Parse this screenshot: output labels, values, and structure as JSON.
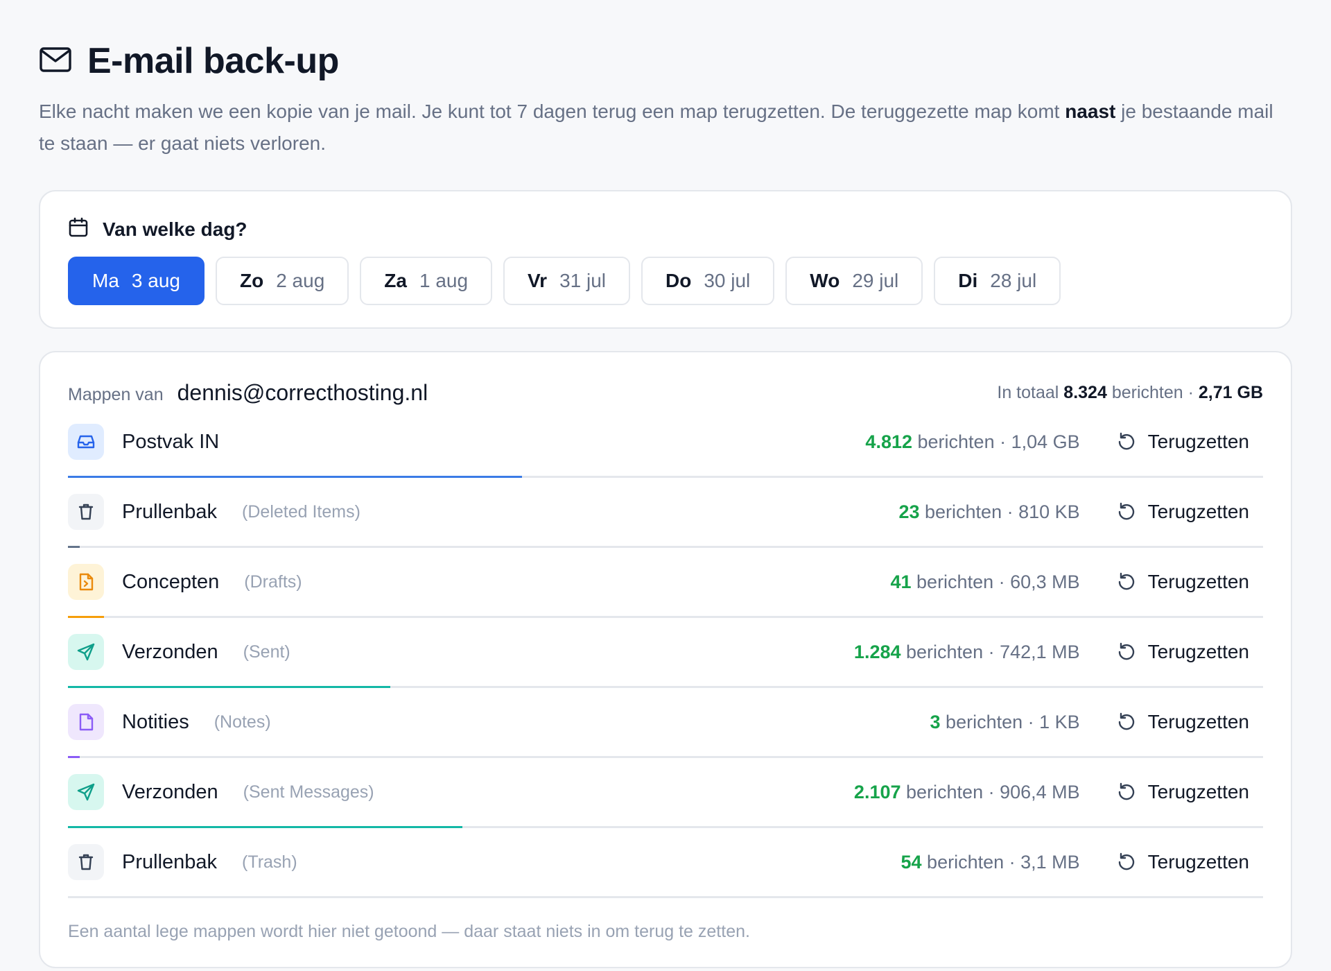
{
  "header": {
    "icon": "mail-icon",
    "title": "E-mail back-up",
    "intro_before": "Elke nacht maken we een kopie van je mail. Je kunt tot 7 dagen terug een map terugzetten. De teruggezette map komt",
    "intro_bold": "naast",
    "intro_after": "je bestaande mail te staan — er gaat niets verloren."
  },
  "day_picker": {
    "icon": "calendar-icon",
    "heading": "Van welke dag?",
    "selected": 0,
    "days": [
      {
        "day": "Ma",
        "date": "3 aug"
      },
      {
        "day": "Zo",
        "date": "2 aug"
      },
      {
        "day": "Za",
        "date": "1 aug"
      },
      {
        "day": "Vr",
        "date": "31 jul"
      },
      {
        "day": "Do",
        "date": "30 jul"
      },
      {
        "day": "Wo",
        "date": "29 jul"
      },
      {
        "day": "Di",
        "date": "28 jul"
      }
    ]
  },
  "folders": {
    "label": "Mappen van",
    "account": "dennis@correcthosting.nl",
    "total_prefix": "In totaal",
    "total_count": "8.324",
    "total_middle": "berichten ·",
    "total_size": "2,71 GB",
    "restore_label": "Terugzetten",
    "restore_icon": "restore-icon",
    "items": [
      {
        "name": "Postvak IN",
        "alias": "",
        "count": "4.812",
        "unit": "berichten",
        "size": "· 1,04 GB",
        "icon": "inbox-icon",
        "color": "#2563eb",
        "bg": "#e0ecff",
        "bar_color": "#3b7be6",
        "share": 0.38
      },
      {
        "name": "Prullenbak",
        "alias": "(Deleted Items)",
        "count": "23",
        "unit": "berichten",
        "size": "· 810 KB",
        "icon": "trash-icon",
        "color": "#344054",
        "bg": "#f2f4f7",
        "bar_color": "#64748b",
        "share": 0.01
      },
      {
        "name": "Concepten",
        "alias": "(Drafts)",
        "count": "41",
        "unit": "berichten",
        "size": "· 60,3 MB",
        "icon": "draft-icon",
        "color": "#ea8a0c",
        "bg": "#fef3d7",
        "bar_color": "#f59e0b",
        "share": 0.03
      },
      {
        "name": "Verzonden",
        "alias": "(Sent)",
        "count": "1.284",
        "unit": "berichten",
        "size": "· 742,1 MB",
        "icon": "send-icon",
        "color": "#0f9f8a",
        "bg": "#d7f7ef",
        "bar_color": "#14b8a6",
        "share": 0.27
      },
      {
        "name": "Notities",
        "alias": "(Notes)",
        "count": "3",
        "unit": "berichten",
        "size": "· 1 KB",
        "icon": "note-icon",
        "color": "#8b5cf6",
        "bg": "#efe7fd",
        "bar_color": "#8b5cf6",
        "share": 0.01
      },
      {
        "name": "Verzonden",
        "alias": "(Sent Messages)",
        "count": "2.107",
        "unit": "berichten",
        "size": "· 906,4 MB",
        "icon": "send-icon",
        "color": "#0f9f8a",
        "bg": "#d7f7ef",
        "bar_color": "#14b8a6",
        "share": 0.33
      },
      {
        "name": "Prullenbak",
        "alias": "(Trash)",
        "count": "54",
        "unit": "berichten",
        "size": "· 3,1 MB",
        "icon": "trash-icon",
        "color": "#344054",
        "bg": "#f2f4f7",
        "bar_color": "#64748b",
        "share": 0.0
      }
    ],
    "footnote": "Een aantal lege mappen wordt hier niet getoond — daar staat niets in om terug te zetten."
  }
}
